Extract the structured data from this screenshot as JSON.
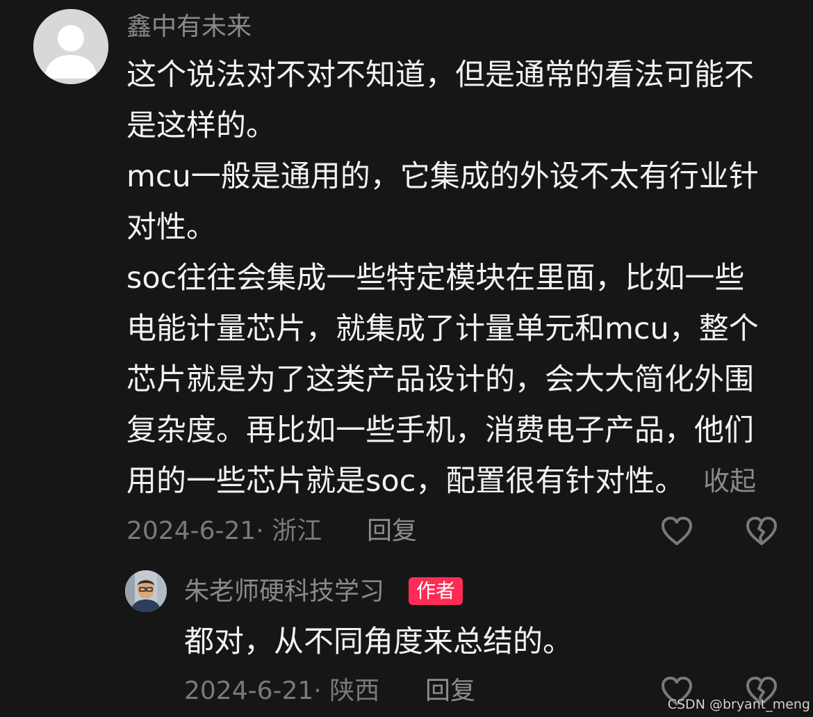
{
  "comment": {
    "username": "鑫中有未来",
    "lines": [
      "这个说法对不对不知道，但是通常的看法可能不",
      "是这样的。",
      "mcu一般是通用的，它集成的外设不太有行业针",
      "对性。",
      "soc往往会集成一些特定模块在里面，比如一些",
      "电能计量芯片，就集成了计量单元和mcu，整个",
      "芯片就是为了这类产品设计的，会大大简化外围",
      "复杂度。再比如一些手机，消费电子产品，他们",
      "用的一些芯片就是soc，配置很有针对性。"
    ],
    "collapse_label": "收起",
    "meta": "2024-6-21· 浙江",
    "reply_label": "回复",
    "like_icon": "heart-outline-icon",
    "dislike_icon": "broken-heart-icon"
  },
  "reply": {
    "username": "朱老师硬科技学习",
    "badge": "作者",
    "text": "都对，从不同角度来总结的。",
    "meta": "2024-6-21· 陕西",
    "reply_label": "回复"
  },
  "watermark": "CSDN @bryant_meng",
  "colors": {
    "background": "#161616",
    "text": "#f2f2f2",
    "muted": "#8a8a8a",
    "badge": "#fe2c55"
  }
}
